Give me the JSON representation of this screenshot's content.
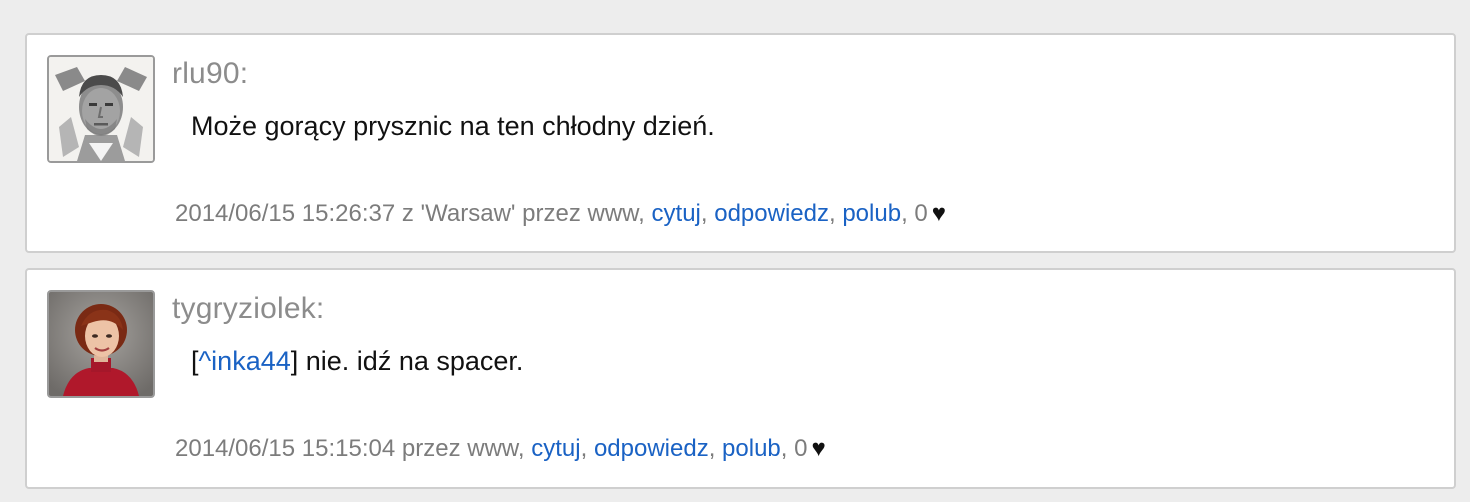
{
  "posts": [
    {
      "username": "rlu90:",
      "message": "Może gorący prysznic na ten chłodny dzień.",
      "meta_prefix": "2014/06/15 15:26:37 z 'Warsaw' przez www, ",
      "actions": {
        "quote": "cytuj",
        "reply": "odpowiedz",
        "like": "polub"
      },
      "like_count": "0",
      "heart": "♥",
      "avatar": "man-portrait-bw"
    },
    {
      "username": "tygryziolek:",
      "message_ref_open": "[",
      "message_ref": "^inka44",
      "message_ref_close": "]",
      "message": " nie. idź na spacer.",
      "meta_prefix": "2014/06/15 15:15:04 przez www, ",
      "actions": {
        "quote": "cytuj",
        "reply": "odpowiedz",
        "like": "polub"
      },
      "like_count": "0",
      "heart": "♥",
      "avatar": "woman-portrait-color"
    }
  ],
  "colors": {
    "link": "#1a62c4",
    "meta_text": "#7c7c7c",
    "username": "#8c8c8c",
    "background": "#ededed"
  }
}
